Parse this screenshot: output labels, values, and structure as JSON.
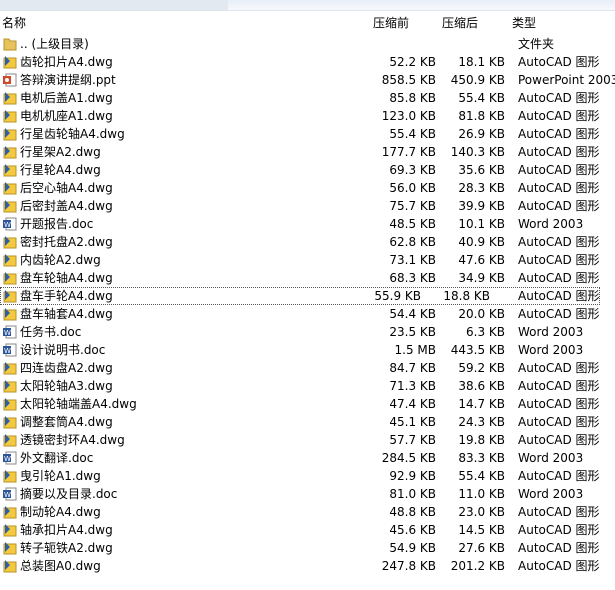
{
  "columns": {
    "name": "名称",
    "before": "压缩前",
    "after": "压缩后",
    "type": "类型"
  },
  "rows": [
    {
      "name": ".. (上级目录)",
      "before": "",
      "after": "",
      "type": "文件夹",
      "icon": "folder"
    },
    {
      "name": "齿轮扣片A4.dwg",
      "before": "52.2 KB",
      "after": "18.1 KB",
      "type": "AutoCAD 图形",
      "icon": "dwg"
    },
    {
      "name": "答辩演讲提纲.ppt",
      "before": "858.5 KB",
      "after": "450.9 KB",
      "type": "PowerPoint 2003",
      "icon": "ppt"
    },
    {
      "name": "电机后盖A1.dwg",
      "before": "85.8 KB",
      "after": "55.4 KB",
      "type": "AutoCAD 图形",
      "icon": "dwg"
    },
    {
      "name": "电机机座A1.dwg",
      "before": "123.0 KB",
      "after": "81.8 KB",
      "type": "AutoCAD 图形",
      "icon": "dwg"
    },
    {
      "name": "行星齿轮轴A4.dwg",
      "before": "55.4 KB",
      "after": "26.9 KB",
      "type": "AutoCAD 图形",
      "icon": "dwg"
    },
    {
      "name": "行星架A2.dwg",
      "before": "177.7 KB",
      "after": "140.3 KB",
      "type": "AutoCAD 图形",
      "icon": "dwg"
    },
    {
      "name": "行星轮A4.dwg",
      "before": "69.3 KB",
      "after": "35.6 KB",
      "type": "AutoCAD 图形",
      "icon": "dwg"
    },
    {
      "name": "后空心轴A4.dwg",
      "before": "56.0 KB",
      "after": "28.3 KB",
      "type": "AutoCAD 图形",
      "icon": "dwg"
    },
    {
      "name": "后密封盖A4.dwg",
      "before": "75.7 KB",
      "after": "39.9 KB",
      "type": "AutoCAD 图形",
      "icon": "dwg"
    },
    {
      "name": "开题报告.doc",
      "before": "48.5 KB",
      "after": "10.1 KB",
      "type": "Word 2003",
      "icon": "doc"
    },
    {
      "name": "密封托盘A2.dwg",
      "before": "62.8 KB",
      "after": "40.9 KB",
      "type": "AutoCAD 图形",
      "icon": "dwg"
    },
    {
      "name": "内齿轮A2.dwg",
      "before": "73.1 KB",
      "after": "47.6 KB",
      "type": "AutoCAD 图形",
      "icon": "dwg"
    },
    {
      "name": "盘车轮轴A4.dwg",
      "before": "68.3 KB",
      "after": "34.9 KB",
      "type": "AutoCAD 图形",
      "icon": "dwg"
    },
    {
      "name": "盘车手轮A4.dwg",
      "before": "55.9 KB",
      "after": "18.8 KB",
      "type": "AutoCAD 图形",
      "icon": "dwg",
      "focus": true
    },
    {
      "name": "盘车轴套A4.dwg",
      "before": "54.4 KB",
      "after": "20.0 KB",
      "type": "AutoCAD 图形",
      "icon": "dwg"
    },
    {
      "name": "任务书.doc",
      "before": "23.5 KB",
      "after": "6.3 KB",
      "type": "Word 2003",
      "icon": "doc"
    },
    {
      "name": "设计说明书.doc",
      "before": "1.5 MB",
      "after": "443.5 KB",
      "type": "Word 2003",
      "icon": "doc"
    },
    {
      "name": "四连齿盘A2.dwg",
      "before": "84.7 KB",
      "after": "59.2 KB",
      "type": "AutoCAD 图形",
      "icon": "dwg"
    },
    {
      "name": "太阳轮轴A3.dwg",
      "before": "71.3 KB",
      "after": "38.6 KB",
      "type": "AutoCAD 图形",
      "icon": "dwg"
    },
    {
      "name": "太阳轮轴端盖A4.dwg",
      "before": "47.4 KB",
      "after": "14.7 KB",
      "type": "AutoCAD 图形",
      "icon": "dwg"
    },
    {
      "name": "调整套筒A4.dwg",
      "before": "45.1 KB",
      "after": "24.3 KB",
      "type": "AutoCAD 图形",
      "icon": "dwg"
    },
    {
      "name": "透镜密封环A4.dwg",
      "before": "57.7 KB",
      "after": "19.8 KB",
      "type": "AutoCAD 图形",
      "icon": "dwg"
    },
    {
      "name": "外文翻译.doc",
      "before": "284.5 KB",
      "after": "83.3 KB",
      "type": "Word 2003",
      "icon": "doc"
    },
    {
      "name": "曳引轮A1.dwg",
      "before": "92.9 KB",
      "after": "55.4 KB",
      "type": "AutoCAD 图形",
      "icon": "dwg"
    },
    {
      "name": "摘要以及目录.doc",
      "before": "81.0 KB",
      "after": "11.0 KB",
      "type": "Word 2003",
      "icon": "doc"
    },
    {
      "name": "制动轮A4.dwg",
      "before": "48.8 KB",
      "after": "23.0 KB",
      "type": "AutoCAD 图形",
      "icon": "dwg"
    },
    {
      "name": "轴承扣片A4.dwg",
      "before": "45.6 KB",
      "after": "14.5 KB",
      "type": "AutoCAD 图形",
      "icon": "dwg"
    },
    {
      "name": "转子轭铁A2.dwg",
      "before": "54.9 KB",
      "after": "27.6 KB",
      "type": "AutoCAD 图形",
      "icon": "dwg"
    },
    {
      "name": "总装图A0.dwg",
      "before": "247.8 KB",
      "after": "201.2 KB",
      "type": "AutoCAD 图形",
      "icon": "dwg"
    }
  ]
}
